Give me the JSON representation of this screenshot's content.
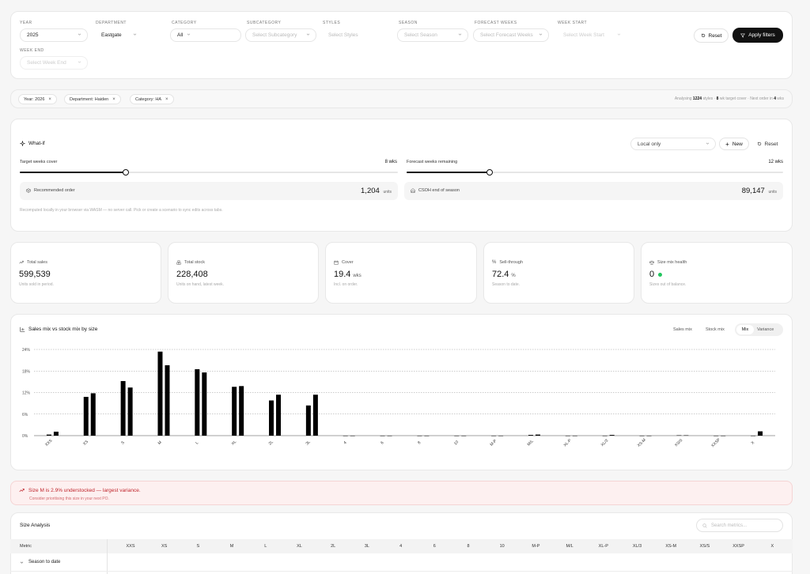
{
  "filters": {
    "year": {
      "label": "YEAR",
      "value": "2025"
    },
    "department": {
      "label": "DEPARTMENT",
      "value": "Eastgate"
    },
    "category": {
      "label": "CATEGORY",
      "value": "All"
    },
    "subcategory": {
      "label": "SUBCATEGORY",
      "placeholder": "Select Subcategory"
    },
    "styles": {
      "label": "STYLES",
      "placeholder": "Select Styles"
    },
    "season": {
      "label": "SEASON",
      "placeholder": "Select Season"
    },
    "forecast_weeks": {
      "label": "FORECAST WEEKS",
      "placeholder": "Select Forecast Weeks"
    },
    "week_start": {
      "label": "WEEK START",
      "placeholder": "Select Week Start"
    },
    "week_end": {
      "label": "WEEK END",
      "placeholder": "Select Week End"
    },
    "reset_label": "Reset",
    "apply_label": "Apply filters"
  },
  "active_chips": [
    "Year: 2026",
    "Department: Haiden",
    "Category: HA"
  ],
  "analysing": {
    "prefix": "Analysing",
    "styles": "1224",
    "mid": "styles ·",
    "weeks": "8",
    "mid2": "wk target cover · Next order in",
    "next": "4",
    "suffix": "wks"
  },
  "whatif": {
    "title": "What-if",
    "mode": "Local only",
    "new_label": "New",
    "reset_label": "Reset",
    "target_label": "Target weeks cover",
    "target_value": "8 wks",
    "target_fraction": 0.28,
    "forecast_label": "Forecast weeks remaining",
    "forecast_value": "12 wks",
    "forecast_fraction": 0.22,
    "rec_label": "Recommended order",
    "rec_value": "1,204",
    "rec_unit": "units",
    "csoh_label": "CSOH end of season",
    "csoh_value": "89,147",
    "csoh_unit": "units",
    "note": "Recomputed locally in your browser via WASM — no server call. Pick or create a scenario to sync edits across tabs."
  },
  "stats": [
    {
      "title": "Total sales",
      "value": "599,539",
      "unit": "",
      "sub": "Units sold in period.",
      "icon": "trend-icon"
    },
    {
      "title": "Total stock",
      "value": "228,408",
      "unit": "",
      "sub": "Units on hand, latest week.",
      "icon": "boxes-icon"
    },
    {
      "title": "Cover",
      "value": "19.4",
      "unit": "wks",
      "sub": "Incl. on order.",
      "icon": "calendar-icon"
    },
    {
      "title": "Sell-through",
      "value": "72.4",
      "unit": "%",
      "sub": "Season to date.",
      "icon": "percent-icon"
    },
    {
      "title": "Size mix health",
      "value": "0",
      "unit": "",
      "sub": "Sizes out of balance.",
      "icon": "scale-icon",
      "dot_color": "#22c55e"
    }
  ],
  "chart": {
    "title": "Sales mix vs stock mix by size",
    "toggles": [
      "Sales mix",
      "Stock mix",
      "Mix",
      "Variance"
    ],
    "active_toggle": "Mix"
  },
  "chart_data": {
    "type": "bar",
    "categories": [
      "XXS",
      "XS",
      "S",
      "M",
      "L",
      "XL",
      "2L",
      "3L",
      "4",
      "6",
      "8",
      "10",
      "M-P",
      "M/L",
      "XL-P",
      "XL/3",
      "XS-M",
      "XS/S",
      "XXSP",
      "X"
    ],
    "series": [
      {
        "name": "Sales mix",
        "values": [
          0.3,
          10.8,
          15.2,
          23.4,
          18.5,
          13.6,
          9.8,
          8.4,
          0,
          0,
          0,
          0,
          0,
          0.2,
          0,
          0,
          0,
          0.1,
          0,
          0
        ]
      },
      {
        "name": "Stock mix",
        "values": [
          1.1,
          11.8,
          13.4,
          19.6,
          17.6,
          13.8,
          11.4,
          11.4,
          0,
          0,
          0,
          0,
          0,
          0.3,
          0,
          0.2,
          0,
          0.1,
          0,
          1.2
        ]
      }
    ],
    "yticks": [
      "24%",
      "18%",
      "12%",
      "6%",
      "0%"
    ],
    "ylim": [
      0,
      24
    ],
    "grid": true
  },
  "alert": {
    "title": "Size M is 2.9% understocked — largest variance.",
    "sub": "Consider prioritising this size in your next PO."
  },
  "size_analysis": {
    "title": "Size Analysis",
    "search_placeholder": "Search metrics...",
    "columns": [
      "Metric",
      "XXS",
      "XS",
      "S",
      "M",
      "L",
      "XL",
      "2L",
      "3L",
      "4",
      "6",
      "8",
      "10",
      "M-P",
      "M/L",
      "XL-P",
      "XL/3",
      "XS-M",
      "XS/S",
      "XXSP",
      "X"
    ],
    "group": "Season to date"
  }
}
